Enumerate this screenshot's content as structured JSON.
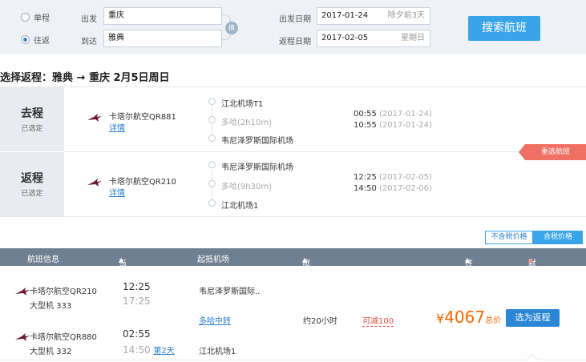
{
  "search": {
    "trip_types": [
      {
        "label": "单程",
        "selected": false
      },
      {
        "label": "往返",
        "selected": true
      }
    ],
    "from_label": "出发",
    "from_value": "重庆",
    "to_label": "到达",
    "to_value": "雅典",
    "swap_label": "换",
    "depart_label": "出发日期",
    "depart_value": "2017-01-24",
    "depart_hint": "除夕前3天",
    "return_label": "返程日期",
    "return_value": "2017-02-05",
    "return_hint": "星期日",
    "button_label": "搜索航班"
  },
  "heading": "选择返程：雅典 → 重庆  2月5日周日",
  "legs": [
    {
      "tag": "去程",
      "status": "已选定",
      "airline": "卡塔尔航空QR881",
      "details": "详情",
      "origin": "江北机场T1",
      "stopover": "多哈(2h10m)",
      "destination": "韦尼泽罗斯国际机场",
      "dep_time": "00:55",
      "dep_date": "(2017-01-24)",
      "arr_time": "10:55",
      "arr_date": "(2017-01-24)"
    },
    {
      "tag": "返程",
      "status": "已选定",
      "airline": "卡塔尔航空QR210",
      "details": "详情",
      "origin": "韦尼泽罗斯国际机场",
      "stopover": "多哈(9h30m)",
      "destination": "江北机场1",
      "dep_time": "12:25",
      "dep_date": "(2017-02-05)",
      "arr_time": "14:50",
      "arr_date": "(2017-02-06)"
    }
  ],
  "rechoose": "重选航班",
  "tax_toggle": {
    "without": "不含税价格",
    "with": "含税价格"
  },
  "table_header": {
    "info": "航班信息",
    "time": "当地起降时间",
    "airport": "起抵机场",
    "duration": "旅行总时长",
    "price": "往返 价格",
    "sort": "默认排序"
  },
  "result": {
    "seg1_airline": "卡塔尔航空QR210",
    "seg1_plane": "大型机 333",
    "seg1_dep": "12:25",
    "seg1_arr": "17:25",
    "seg1_airport": "韦尼泽罗斯国际..",
    "transfer": "多哈中转",
    "seg2_airline": "卡塔尔航空QR880",
    "seg2_plane": "大型机 332",
    "seg2_dep": "02:55",
    "seg2_arr": "14:50",
    "next_day": "第2天",
    "seg2_airport": "江北机场1",
    "duration": "约20小时",
    "discount": "可减100",
    "price_symbol": "¥",
    "price_value": "4067",
    "price_suffix": "总价",
    "choose_button": "选为返程"
  },
  "colors": {
    "accent": "#3aa4e8",
    "price": "#f56a00",
    "header": "#6f8093",
    "alert": "#f07163"
  }
}
